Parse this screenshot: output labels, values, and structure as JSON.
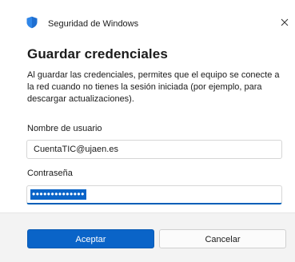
{
  "window": {
    "app_title": "Seguridad de Windows",
    "close_icon": "close-icon",
    "app_icon": "windows-security-shield-icon"
  },
  "dialog": {
    "heading": "Guardar credenciales",
    "description": "Al guardar las credenciales, permites que el equipo se conecte a la red cuando no tienes la sesión iniciada (por ejemplo, para descargar actualizaciones)."
  },
  "form": {
    "username_label": "Nombre de usuario",
    "username_value": "CuentaTIC@ujaen.es",
    "password_label": "Contraseña",
    "password_value": "••••••••••••••"
  },
  "buttons": {
    "accept_label": "Aceptar",
    "cancel_label": "Cancelar"
  },
  "colors": {
    "accent": "#0a64c8",
    "footer_bg": "#f3f3f3"
  }
}
